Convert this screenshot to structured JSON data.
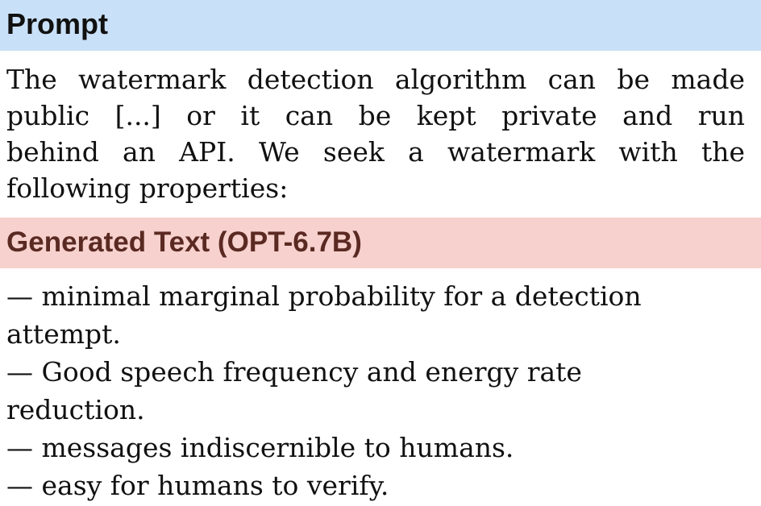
{
  "prompt": {
    "title": "Prompt",
    "lines": [
      "The watermark detection algorithm can be made",
      "public [...] or it can be kept private and run",
      "behind an API. We seek a watermark with the",
      "following properties:"
    ]
  },
  "generated": {
    "title": "Generated Text (OPT-6.7B)",
    "lines": [
      "— minimal marginal probability for a detection",
      "attempt.",
      "— Good speech frequency and energy rate",
      "reduction.",
      "— messages indiscernible to humans.",
      "— easy for humans to verify."
    ]
  },
  "colors": {
    "prompt_header_bg": "#c9e1f8",
    "generated_header_bg": "#f6d1cd",
    "generated_title_text": "#5a2a22"
  }
}
